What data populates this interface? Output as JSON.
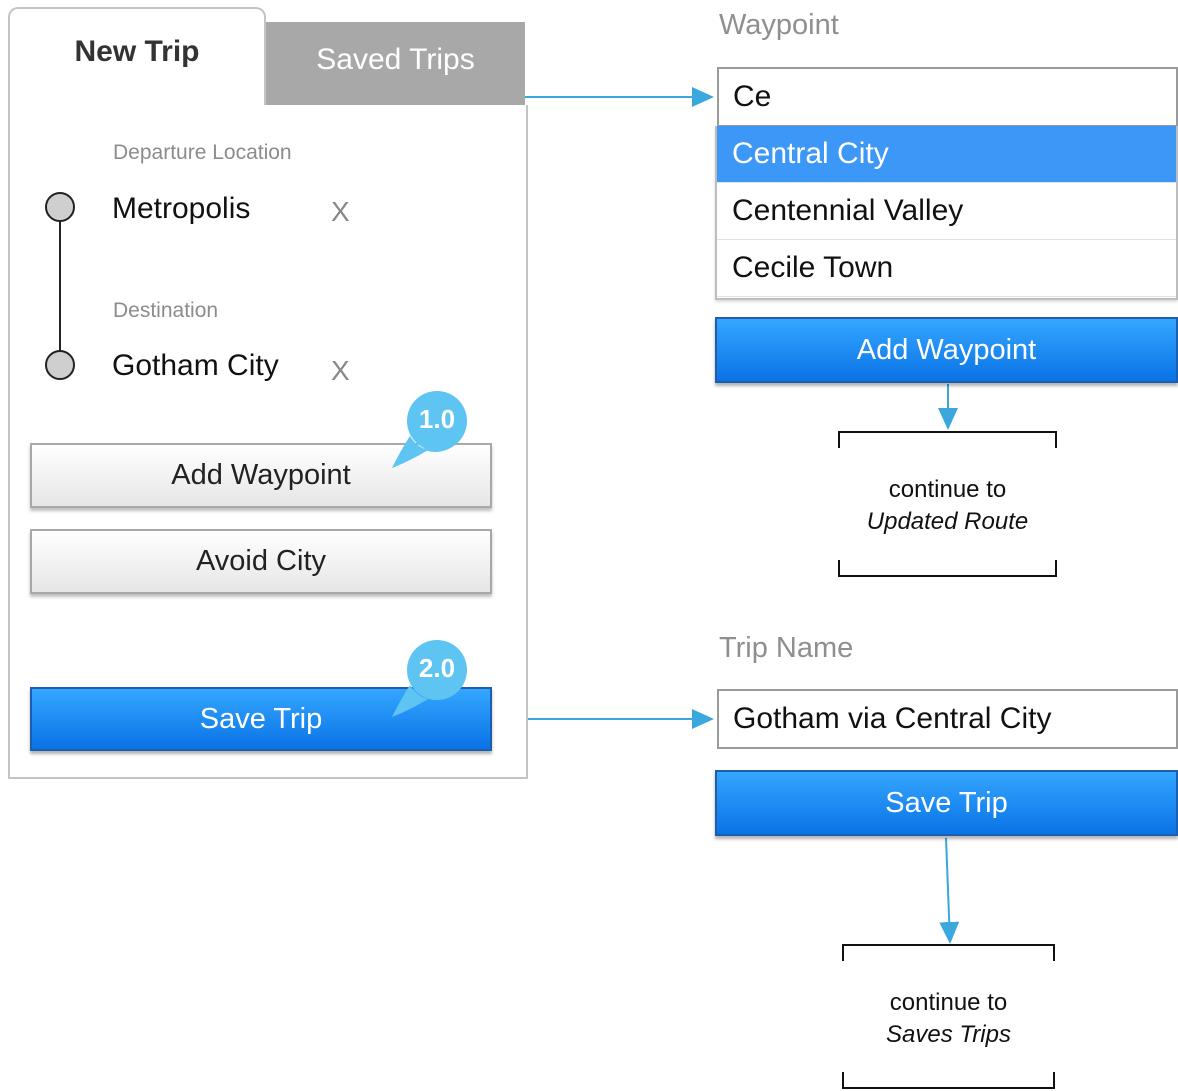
{
  "tabs": {
    "active": "New Trip",
    "inactive": "Saved Trips"
  },
  "trip": {
    "departure_label": "Departure Location",
    "departure_value": "Metropolis",
    "destination_label": "Destination",
    "destination_value": "Gotham City",
    "clear_glyph": "X"
  },
  "buttons": {
    "add_waypoint": "Add Waypoint",
    "avoid_city": "Avoid City",
    "save_trip": "Save Trip"
  },
  "badges": [
    "1.0",
    "2.0"
  ],
  "waypoint_panel": {
    "label": "Waypoint",
    "input_value": "Ce",
    "suggestions": [
      "Central City",
      "Centennial Valley",
      "Cecile Town"
    ],
    "selected_index": 0,
    "button": "Add Waypoint",
    "note_line1": "continue to",
    "note_line2": "Updated Route"
  },
  "trip_name_panel": {
    "label": "Trip Name",
    "input_value": "Gotham via Central City",
    "button": "Save Trip",
    "note_line1": "continue to",
    "note_line2": "Saves Trips"
  },
  "colors": {
    "arrow": "#3aa8dc",
    "badge": "#5ec4f2",
    "primary_button": "#1a84f0",
    "selected_item": "#3d97f7"
  }
}
